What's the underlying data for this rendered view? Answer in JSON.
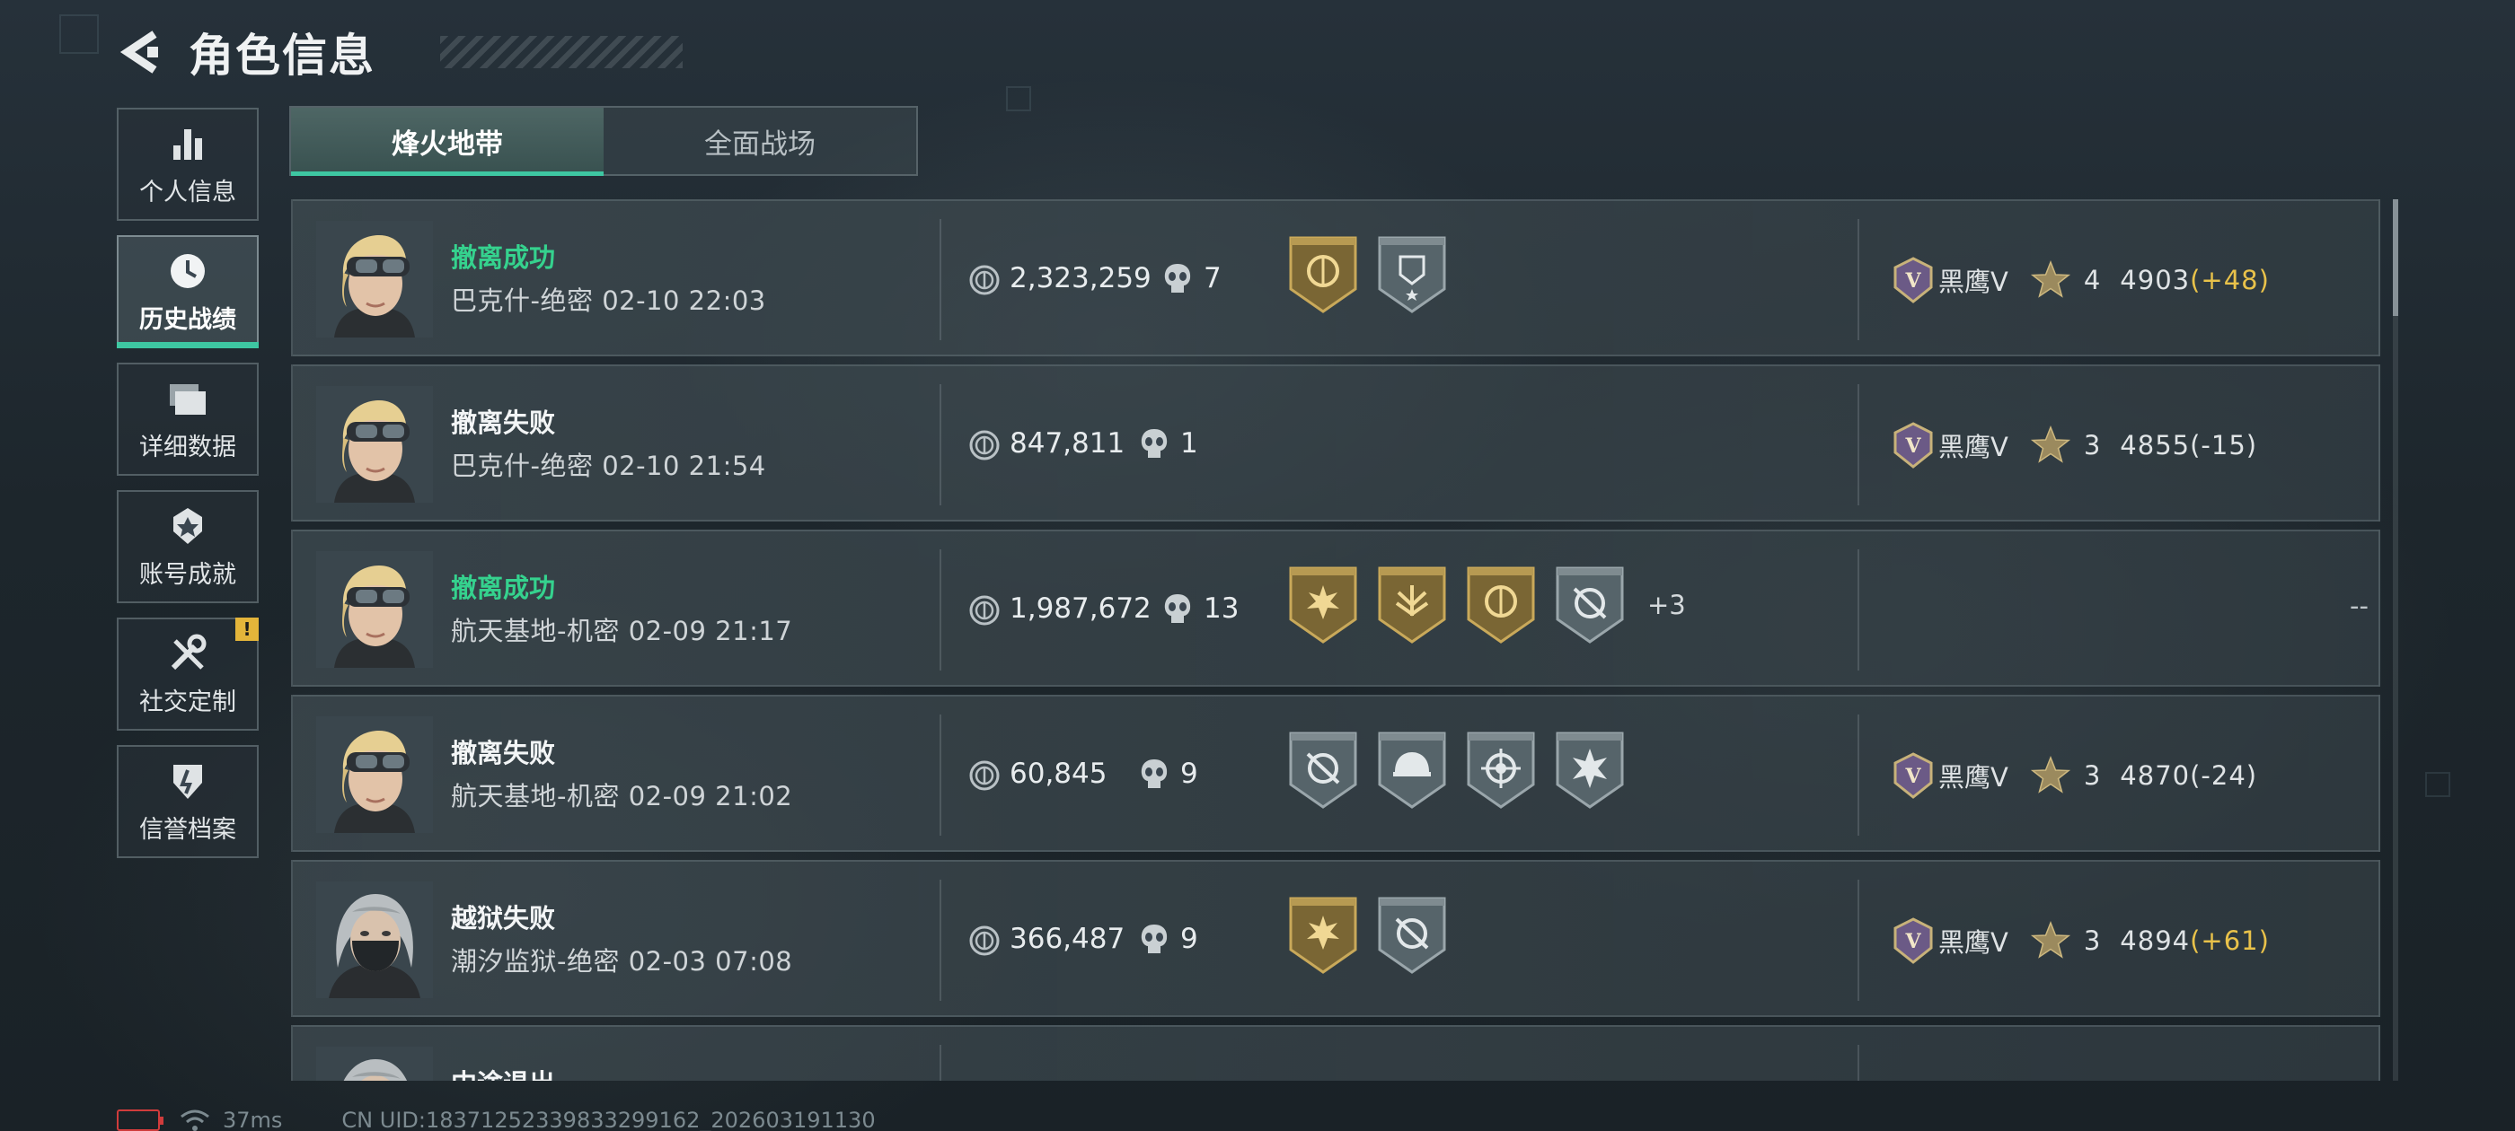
{
  "header": {
    "title": "角色信息"
  },
  "sidebar": {
    "items": [
      {
        "label": "个人信息",
        "icon": "bar-chart-icon"
      },
      {
        "label": "历史战绩",
        "icon": "clock-icon",
        "active": true
      },
      {
        "label": "详细数据",
        "icon": "folder-icon"
      },
      {
        "label": "账号成就",
        "icon": "achievement-icon"
      },
      {
        "label": "社交定制",
        "icon": "tools-icon",
        "badge": "!"
      },
      {
        "label": "信誉档案",
        "icon": "credit-icon"
      }
    ]
  },
  "tabs": [
    {
      "label": "烽火地带",
      "active": true
    },
    {
      "label": "全面战场",
      "active": false
    }
  ],
  "records": [
    {
      "status": "撤离成功",
      "success": true,
      "map": "巴克什-绝密",
      "time": "02-10 22:03",
      "amount": "2,323,259",
      "kills": "7",
      "medals": [
        "gold-emblem",
        "silver-shield-star"
      ],
      "more": "",
      "rank": "黑鹰V",
      "stars": "4",
      "score": "4903",
      "delta": "(+48)",
      "delta_sign": "pos",
      "avatar": "blonde-goggles"
    },
    {
      "status": "撤离失败",
      "success": false,
      "map": "巴克什-绝密",
      "time": "02-10 21:54",
      "amount": "847,811",
      "kills": "1",
      "medals": [],
      "more": "",
      "rank": "黑鹰V",
      "stars": "3",
      "score": "4855",
      "delta": "(-15)",
      "delta_sign": "neg",
      "avatar": "blonde-goggles"
    },
    {
      "status": "撤离成功",
      "success": true,
      "map": "航天基地-机密",
      "time": "02-09 21:17",
      "amount": "1,987,672",
      "kills": "13",
      "medals": [
        "gold-sun",
        "gold-wings",
        "gold-emblem",
        "silver-crosshair"
      ],
      "more": "+3",
      "rank": "",
      "stars": "",
      "score": "",
      "delta": "",
      "delta_sign": "",
      "dash": "--",
      "avatar": "blonde-goggles"
    },
    {
      "status": "撤离失败",
      "success": false,
      "map": "航天基地-机密",
      "time": "02-09 21:02",
      "amount": "60,845",
      "kills": "9",
      "medals": [
        "silver-crosshair",
        "silver-helmet",
        "silver-target",
        "silver-burst"
      ],
      "more": "",
      "rank": "黑鹰V",
      "stars": "3",
      "score": "4870",
      "delta": "(-24)",
      "delta_sign": "neg",
      "avatar": "blonde-goggles"
    },
    {
      "status": "越狱失败",
      "success": false,
      "map": "潮汐监狱-绝密",
      "time": "02-03 07:08",
      "amount": "366,487",
      "kills": "9",
      "medals": [
        "gold-sun",
        "silver-crosshair"
      ],
      "more": "",
      "rank": "黑鹰V",
      "stars": "3",
      "score": "4894",
      "delta": "(+61)",
      "delta_sign": "pos",
      "avatar": "silver-mask"
    },
    {
      "status": "中途退出",
      "success": false,
      "map": "",
      "time": "",
      "amount": "",
      "kills": "",
      "medals": [],
      "more": "",
      "rank": "",
      "stars": "",
      "score": "",
      "delta": "",
      "delta_sign": "",
      "avatar": "silver-mask"
    }
  ],
  "footer": {
    "ping": "37ms",
    "uid": "CN UID:18371252339833299162_202603191130"
  },
  "colors": {
    "accent": "#3ec7a2",
    "success": "#35d28e",
    "positive_delta": "#e9c24a",
    "warning_badge": "#e3b43a"
  }
}
